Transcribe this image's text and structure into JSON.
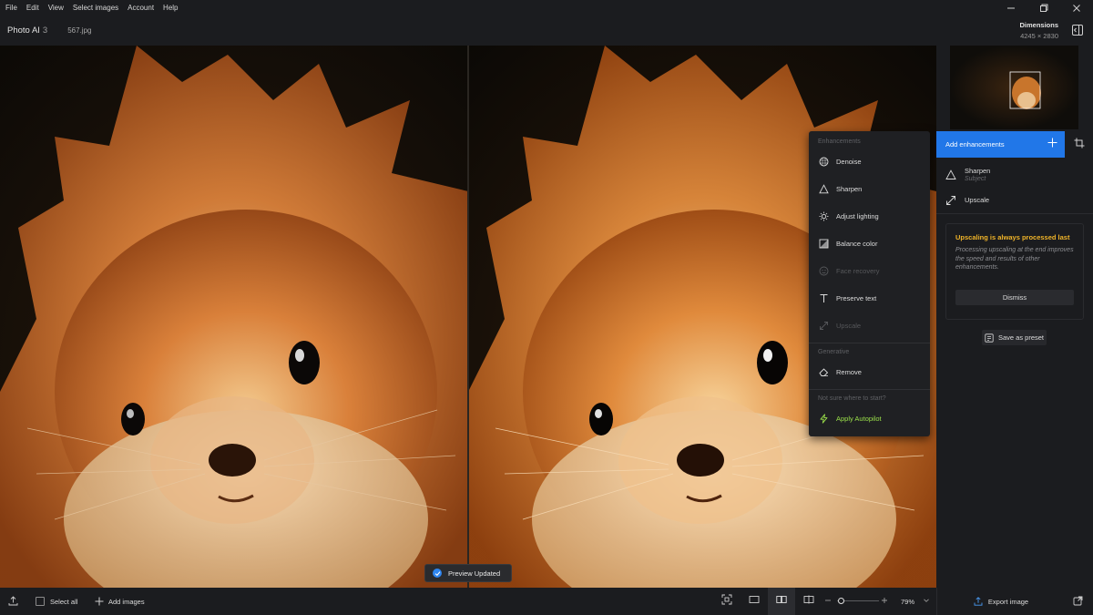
{
  "menubar": {
    "items": [
      "File",
      "Edit",
      "View",
      "Select images",
      "Account",
      "Help"
    ],
    "window_controls": [
      "minimize-icon",
      "restore-icon",
      "close-icon"
    ]
  },
  "header": {
    "app_name": "Photo AI",
    "app_version": "3",
    "filename": "567.jpg",
    "dimensions_label": "Dimensions",
    "dimensions_value": "4245 × 2830"
  },
  "dropdown": {
    "section_enhancements": "Enhancements",
    "items": [
      {
        "label": "Denoise",
        "icon": "denoise-icon",
        "enabled": true
      },
      {
        "label": "Sharpen",
        "icon": "sharpen-icon",
        "enabled": true
      },
      {
        "label": "Adjust lighting",
        "icon": "lighting-icon",
        "enabled": true
      },
      {
        "label": "Balance color",
        "icon": "balance-color-icon",
        "enabled": true
      },
      {
        "label": "Face recovery",
        "icon": "face-icon",
        "enabled": false
      },
      {
        "label": "Preserve text",
        "icon": "text-icon",
        "enabled": true
      },
      {
        "label": "Upscale",
        "icon": "upscale-icon",
        "enabled": false
      }
    ],
    "section_generative": "Generative",
    "generative_items": [
      {
        "label": "Remove",
        "icon": "eraser-icon",
        "enabled": true
      }
    ],
    "section_autopilot": "Not sure where to start?",
    "autopilot_label": "Apply Autopilot"
  },
  "sidebar": {
    "add_enhancements": "Add enhancements",
    "enhancements": [
      {
        "title": "Sharpen",
        "subtitle": "Subject",
        "icon": "sharpen-icon"
      },
      {
        "title": "Upscale",
        "subtitle": "",
        "icon": "upscale-icon"
      }
    ],
    "notice_title": "Upscaling is always processed last",
    "notice_body": "Processing upscaling at the end improves the speed and results of other enhancements.",
    "dismiss_label": "Dismiss",
    "save_preset_label": "Save as preset"
  },
  "toast": {
    "text": "Preview Updated"
  },
  "bottombar": {
    "select_all": "Select all",
    "add_images": "Add images",
    "zoom_value": "79%",
    "zoom_fraction": 0.1,
    "export_label": "Export image"
  },
  "colors": {
    "accent": "#2177e8",
    "warning": "#f0b429",
    "autopilot": "#9be14a",
    "background": "#1b1c1f"
  }
}
